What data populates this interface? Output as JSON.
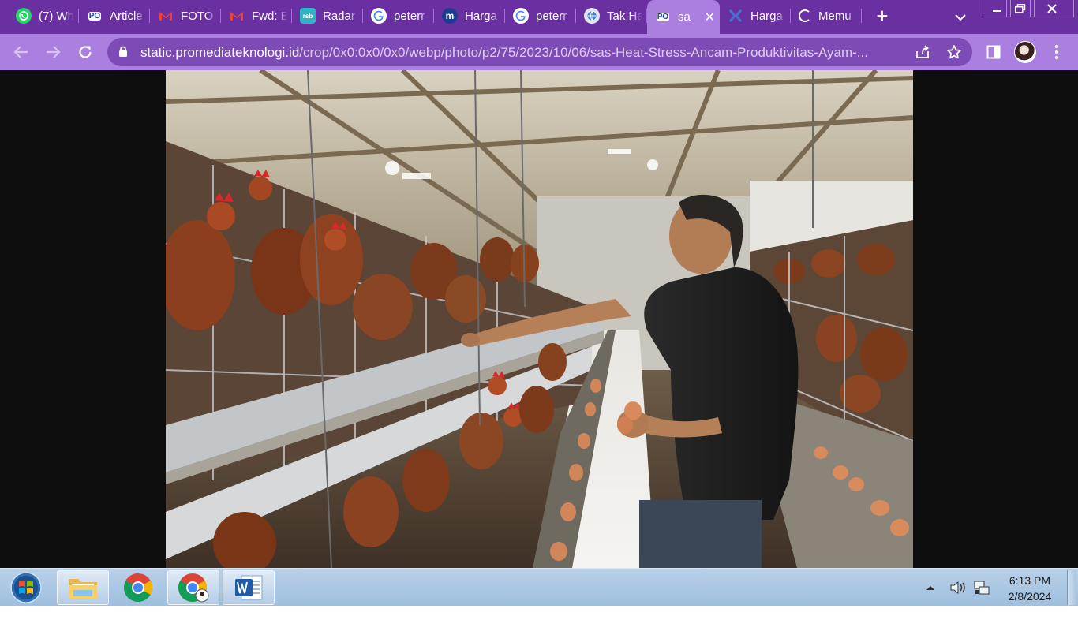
{
  "browser": {
    "tabs": [
      {
        "title": "(7) Wh",
        "favicon": "whatsapp-icon",
        "color": "#25d366",
        "active": false
      },
      {
        "title": "Article",
        "favicon": "promedia-icon",
        "color": "#1a3fa8",
        "active": false
      },
      {
        "title": "FOTO",
        "favicon": "gmail-icon",
        "color": "#ea4335",
        "active": false
      },
      {
        "title": "Fwd: E",
        "favicon": "gmail-icon",
        "color": "#ea4335",
        "active": false
      },
      {
        "title": "Radar",
        "favicon": "rsb-icon",
        "color": "#2fb4c6",
        "active": false
      },
      {
        "title": "peterr",
        "favicon": "google-icon",
        "color": "#4285f4",
        "active": false
      },
      {
        "title": "Harga",
        "favicon": "m-icon",
        "color": "#1d3c8f",
        "active": false
      },
      {
        "title": "peterr",
        "favicon": "google-icon",
        "color": "#4285f4",
        "active": false
      },
      {
        "title": "Tak Ha",
        "favicon": "globe-icon",
        "color": "#dfe6ee",
        "active": false
      },
      {
        "title": "sa",
        "favicon": "promedia-icon",
        "color": "#1a3fa8",
        "active": true
      },
      {
        "title": "Harga",
        "favicon": "x-brand-icon",
        "color": "#4a6fd1",
        "active": false
      },
      {
        "title": "Memu",
        "favicon": "loading-spinner-icon",
        "color": "#ffffff",
        "active": false
      }
    ],
    "tab_close_glyph": "✕",
    "new_tab_glyph": "+",
    "url_host": "static.promediateknologi.id",
    "url_path": "/crop/0x0:0x0/0x0/webp/photo/p2/75/2023/10/06/sas-Heat-Stress-Ancam-Produktivitas-Ayam-...",
    "colors": {
      "tabstrip": "#6a2fa0",
      "toolbar": "#ab7fe0",
      "omnibox": "#7d4bb5"
    }
  },
  "window_controls": {
    "minimize": "—",
    "restore": "❐",
    "close": "✕"
  },
  "content": {
    "image_subject": "photo-poultry-farm"
  },
  "taskbar": {
    "apps": [
      {
        "name": "explorer",
        "icon": "folder-icon"
      },
      {
        "name": "chrome",
        "icon": "chrome-icon"
      },
      {
        "name": "chrome-profile",
        "icon": "chrome-profile-icon"
      },
      {
        "name": "word",
        "icon": "word-icon"
      }
    ],
    "clock_time": "6:13 PM",
    "clock_date": "2/8/2024"
  }
}
